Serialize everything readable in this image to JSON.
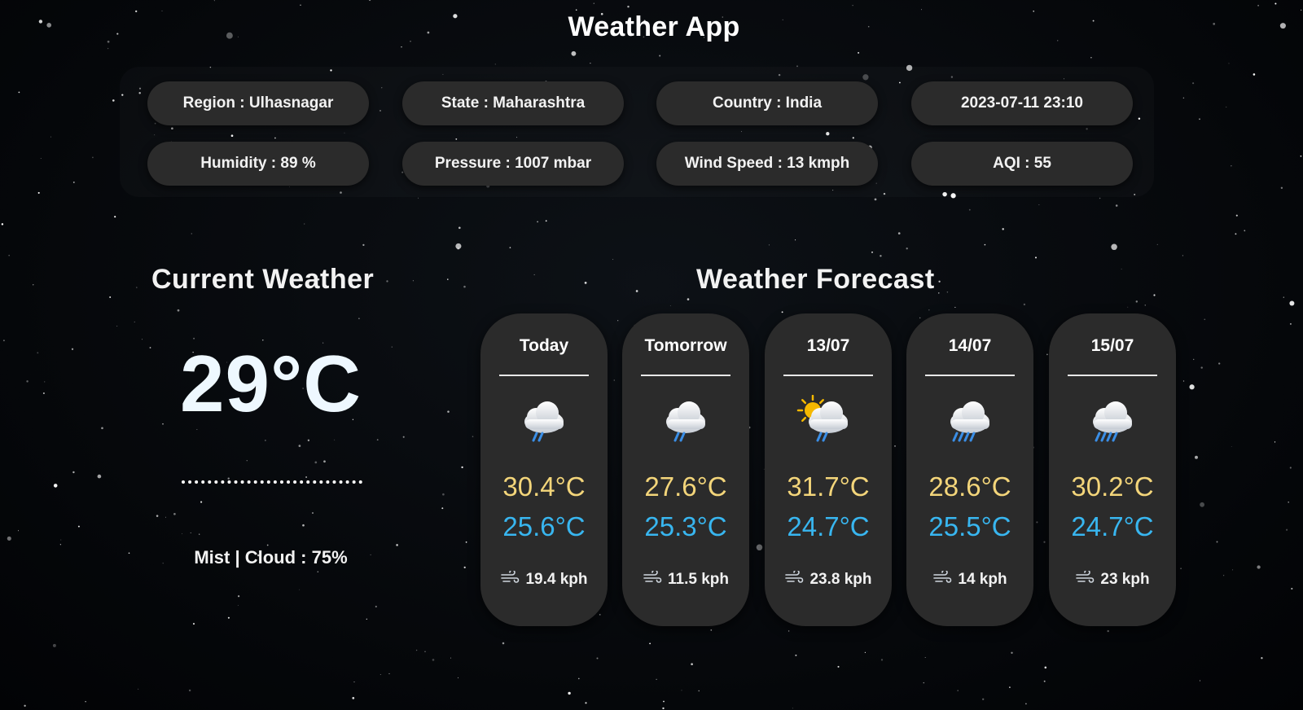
{
  "app": {
    "title": "Weather App"
  },
  "info": {
    "region": "Region : Ulhasnagar",
    "state": "State : Maharashtra",
    "country": "Country : India",
    "datetime": "2023-07-11 23:10",
    "humidity": "Humidity : 89 %",
    "pressure": "Pressure : 1007 mbar",
    "wind_speed": "Wind Speed : 13 kmph",
    "aqi": "AQI : 55"
  },
  "current": {
    "heading": "Current Weather",
    "temperature": "29°C",
    "condition": "Mist | Cloud : 75%"
  },
  "forecast": {
    "heading": "Weather Forecast",
    "days": [
      {
        "day": "Today",
        "icon": "light-rain-cloud-icon",
        "max": "30.4°C",
        "min": "25.6°C",
        "wind": "19.4 kph"
      },
      {
        "day": "Tomorrow",
        "icon": "light-rain-cloud-icon",
        "max": "27.6°C",
        "min": "25.3°C",
        "wind": "11.5 kph"
      },
      {
        "day": "13/07",
        "icon": "sun-cloud-rain-icon",
        "max": "31.7°C",
        "min": "24.7°C",
        "wind": "23.8 kph"
      },
      {
        "day": "14/07",
        "icon": "heavy-rain-cloud-icon",
        "max": "28.6°C",
        "min": "25.5°C",
        "wind": "14 kph"
      },
      {
        "day": "15/07",
        "icon": "heavy-rain-cloud-icon",
        "max": "30.2°C",
        "min": "24.7°C",
        "wind": "23 kph"
      }
    ]
  },
  "colors": {
    "max_temp": "#f3d57a",
    "min_temp": "#38b6f0",
    "card_bg": "#2b2b2b",
    "rain": "#3a8ee6",
    "sun": "#f5b800"
  }
}
